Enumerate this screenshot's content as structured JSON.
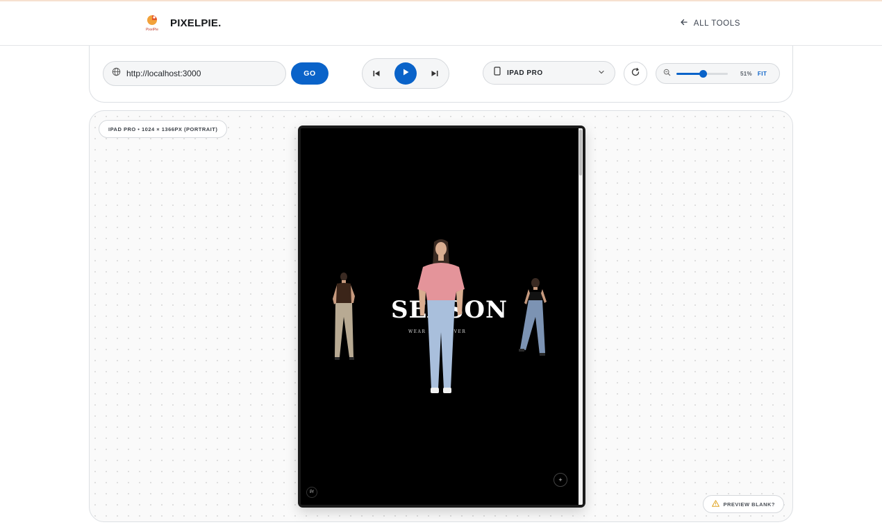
{
  "header": {
    "brand": "PIXELPIE.",
    "logo_caption": "PixelPie",
    "back_link": "ALL TOOLS"
  },
  "toolbar": {
    "url_value": "http://localhost:3000",
    "go_label": "GO",
    "device_label": "IPAD PRO",
    "zoom_value": "51%",
    "zoom_fraction": 0.51,
    "fit_label": "FIT"
  },
  "canvas": {
    "device_info": "IPAD PRO • 1024 × 1366PX (PORTRAIT)",
    "preview_blank": "PREVIEW BLANK?"
  },
  "preview": {
    "hero_title": "SEASON",
    "hero_subtitle": "WEAR IT FOREVER",
    "corner_logo": "P/"
  },
  "icons": {
    "globe": "globe-icon",
    "prev": "skip-previous-icon",
    "play": "play-icon",
    "next": "skip-next-icon",
    "tablet": "tablet-icon",
    "chevron": "chevron-down-icon",
    "refresh": "refresh-icon",
    "zoom": "zoom-icon",
    "warning": "warning-icon",
    "back": "arrow-left-icon"
  },
  "colors": {
    "accent": "#0a63c9",
    "screen_bg": "#000000",
    "frame": "#1a1a1a"
  }
}
